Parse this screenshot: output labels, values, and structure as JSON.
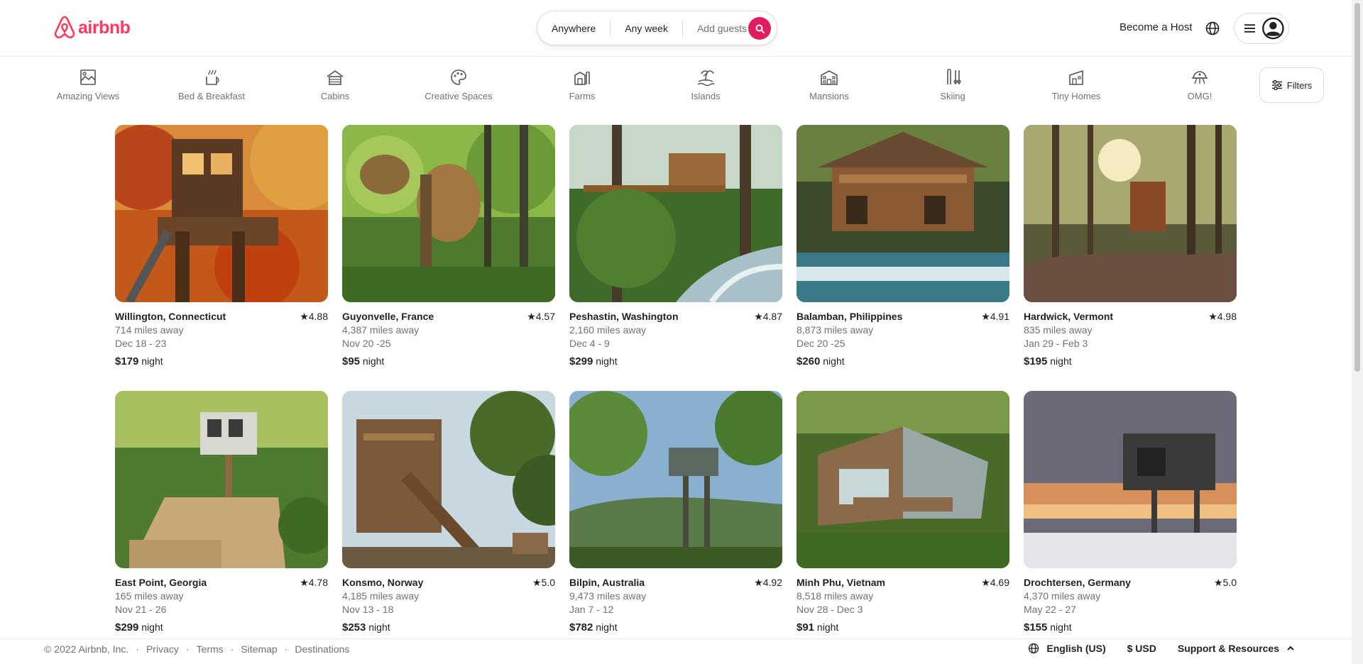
{
  "brand": {
    "name": "airbnb",
    "color": "#ff385c"
  },
  "search": {
    "where": "Anywhere",
    "when": "Any week",
    "guests_placeholder": "Add guests",
    "button_color": "#e31c5f"
  },
  "header": {
    "become_host": "Become a Host"
  },
  "categories": [
    {
      "label": "Amazing Views",
      "icon": "amazing-views-icon"
    },
    {
      "label": "Bed & Breakfast",
      "icon": "bed-breakfast-icon"
    },
    {
      "label": "Cabins",
      "icon": "cabins-icon"
    },
    {
      "label": "Creative Spaces",
      "icon": "creative-spaces-icon"
    },
    {
      "label": "Farms",
      "icon": "farms-icon"
    },
    {
      "label": "Islands",
      "icon": "islands-icon"
    },
    {
      "label": "Mansions",
      "icon": "mansions-icon"
    },
    {
      "label": "Skiing",
      "icon": "skiing-icon"
    },
    {
      "label": "Tiny Homes",
      "icon": "tiny-homes-icon"
    },
    {
      "label": "OMG!",
      "icon": "omg-icon"
    }
  ],
  "filters_label": "Filters",
  "listings": [
    {
      "location": "Willington, Connecticut",
      "rating": "★4.88",
      "distance": "714 miles away",
      "dates": "Dec 18 - 23",
      "price": "$179",
      "unit": "night"
    },
    {
      "location": "Guyonvelle, France",
      "rating": "★4.57",
      "distance": "4,387 miles away",
      "dates": "Nov 20 -25",
      "price": "$95",
      "unit": "night"
    },
    {
      "location": "Peshastin, Washington",
      "rating": "★4.87",
      "distance": "2,160 miles away",
      "dates": "Dec 4 - 9",
      "price": "$299",
      "unit": "night"
    },
    {
      "location": "Balamban, Philippines",
      "rating": "★4.91",
      "distance": "8,873 miles away",
      "dates": "Dec 20 -25",
      "price": "$260",
      "unit": "night"
    },
    {
      "location": "Hardwick, Vermont",
      "rating": "★4.98",
      "distance": "835 miles away",
      "dates": "Jan 29 - Feb 3",
      "price": "$195",
      "unit": "night"
    },
    {
      "location": "East Point, Georgia",
      "rating": "★4.78",
      "distance": "165 miles away",
      "dates": "Nov 21 - 26",
      "price": "$299",
      "unit": "night"
    },
    {
      "location": "Konsmo, Norway",
      "rating": "★5.0",
      "distance": "4,185 miles away",
      "dates": "Nov 13 - 18",
      "price": "$253",
      "unit": "night"
    },
    {
      "location": "Bilpin, Australia",
      "rating": "★4.92",
      "distance": "9,473 miles away",
      "dates": "Jan 7 - 12",
      "price": "$782",
      "unit": "night"
    },
    {
      "location": "Minh Phu, Vietnam",
      "rating": "★4.69",
      "distance": "8,518 miles away",
      "dates": "Nov 28 - Dec 3",
      "price": "$91",
      "unit": "night"
    },
    {
      "location": "Drochtersen, Germany",
      "rating": "★5.0",
      "distance": "4,370 miles away",
      "dates": "May 22 - 27",
      "price": "$155",
      "unit": "night"
    }
  ],
  "footer": {
    "copyright": "© 2022 Airbnb, Inc.",
    "links": [
      "Privacy",
      "Terms",
      "Sitemap",
      "Destinations"
    ],
    "language": "English (US)",
    "currency": "$ USD",
    "support": "Support & Resources"
  }
}
